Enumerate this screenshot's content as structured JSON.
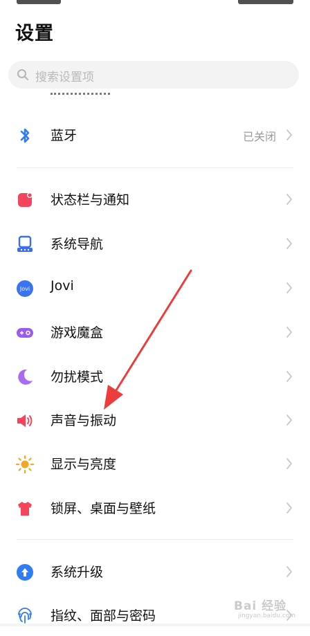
{
  "page": {
    "title": "设置"
  },
  "search": {
    "placeholder": "搜索设置项"
  },
  "groups": [
    {
      "items": [
        {
          "name": "bluetooth",
          "label": "蓝牙",
          "value": "已关闭",
          "icon": "bluetooth-icon"
        }
      ]
    },
    {
      "items": [
        {
          "name": "status-bar",
          "label": "状态栏与通知",
          "icon": "status-bar-icon"
        },
        {
          "name": "navigation",
          "label": "系统导航",
          "icon": "navigation-icon"
        },
        {
          "name": "jovi",
          "label": "Jovi",
          "icon": "jovi-icon",
          "icon_text": "Jovi"
        },
        {
          "name": "game-box",
          "label": "游戏魔盒",
          "icon": "gamepad-icon"
        },
        {
          "name": "do-not-disturb",
          "label": "勿扰模式",
          "icon": "moon-icon"
        },
        {
          "name": "sound",
          "label": "声音与振动",
          "icon": "speaker-icon"
        },
        {
          "name": "display",
          "label": "显示与亮度",
          "icon": "sun-icon"
        },
        {
          "name": "wallpaper",
          "label": "锁屏、桌面与壁纸",
          "icon": "tshirt-icon"
        }
      ]
    },
    {
      "items": [
        {
          "name": "system-update",
          "label": "系统升级",
          "icon": "upgrade-icon"
        },
        {
          "name": "fingerprint",
          "label": "指纹、面部与密码",
          "icon": "fingerprint-icon"
        }
      ]
    }
  ],
  "colors": {
    "bluetooth": "#2f7cf6",
    "status_bar": "#f5455c",
    "navigation": "#3a6df0",
    "jovi": "#3a74f0",
    "game_box": "#9a5cf0",
    "moon": "#a86cf0",
    "speaker": "#f5455c",
    "sun": "#f5a623",
    "tshirt": "#f5455c",
    "upgrade": "#2f7cf6",
    "fingerprint": "#2f7cf6",
    "arrow": "#ee3b3b"
  },
  "watermark": {
    "text": "Bai 经验",
    "sub": "jingyan.baidu.com"
  }
}
